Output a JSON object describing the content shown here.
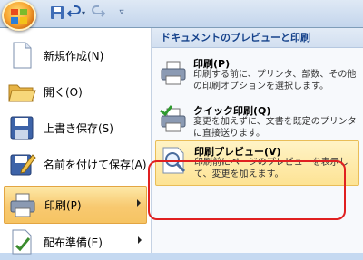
{
  "qat": {
    "icons": [
      "office-button",
      "save-icon",
      "undo-icon",
      "redo-icon",
      "customize-qat"
    ]
  },
  "left_menu": {
    "items": [
      {
        "label": "新規作成(N)",
        "icon": "new-document-icon"
      },
      {
        "label": "開く(O)",
        "icon": "open-folder-icon"
      },
      {
        "label": "上書き保存(S)",
        "icon": "save-icon"
      },
      {
        "label": "名前を付けて保存(A)",
        "icon": "save-as-icon"
      },
      {
        "label": "印刷(P)",
        "icon": "printer-icon"
      },
      {
        "label": "配布準備(E)",
        "icon": "prepare-icon"
      }
    ]
  },
  "right_pane": {
    "header": "ドキュメントのプレビューと印刷",
    "options": [
      {
        "title": "印刷(P)",
        "desc": "印刷する前に、プリンタ、部数、その他の印刷オプションを選択します。",
        "icon": "printer-icon"
      },
      {
        "title": "クイック印刷(Q)",
        "desc": "変更を加えずに、文書を既定のプリンタに直接送ります。",
        "icon": "quick-print-icon"
      },
      {
        "title": "印刷プレビュー(V)",
        "desc": "印刷前にページのプレビューを表示して、変更を加えます。",
        "icon": "print-preview-icon"
      }
    ]
  },
  "colors": {
    "highlight": "#f8c970",
    "annotation": "#e02020"
  }
}
